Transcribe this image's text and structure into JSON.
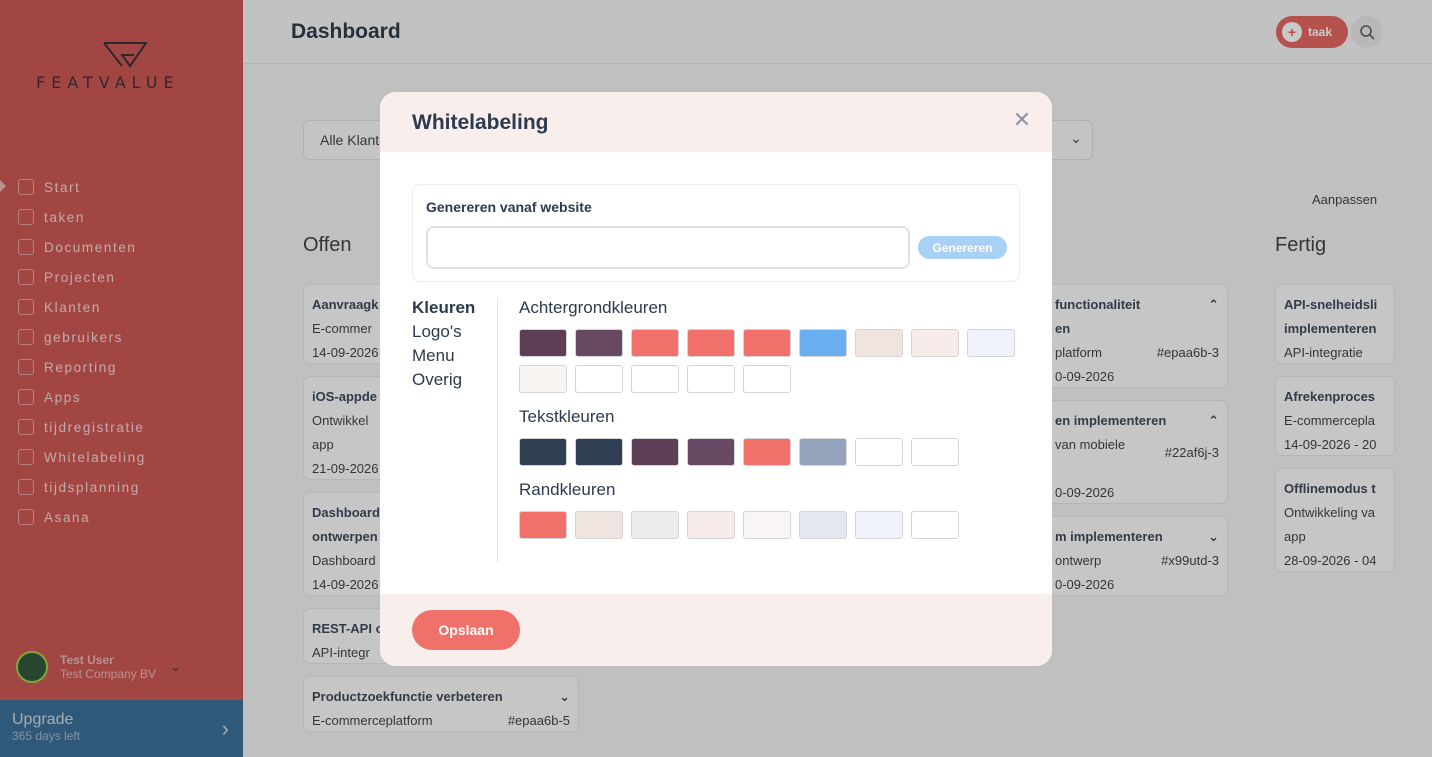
{
  "app": {
    "logo_text": "FEATVALUE",
    "page_title": "Dashboard",
    "add_task_label": "taak"
  },
  "sidebar": {
    "items": [
      {
        "label": "Start",
        "icon": "home-icon"
      },
      {
        "label": "taken",
        "icon": "checklist-icon"
      },
      {
        "label": "Documenten",
        "icon": "document-icon"
      },
      {
        "label": "Projecten",
        "icon": "chart-icon"
      },
      {
        "label": "Klanten",
        "icon": "building-icon"
      },
      {
        "label": "gebruikers",
        "icon": "user-icon"
      },
      {
        "label": "Reporting",
        "icon": "bar-chart-icon"
      },
      {
        "label": "Apps",
        "icon": "apps-icon"
      },
      {
        "label": "tijdregistratie",
        "icon": "clock-icon"
      },
      {
        "label": "Whitelabeling",
        "icon": "globe-icon"
      },
      {
        "label": "tijdsplanning",
        "icon": "calendar-icon"
      },
      {
        "label": "Asana",
        "icon": "apps-icon"
      }
    ],
    "user_name": "Test User",
    "user_company": "Test Company BV",
    "upgrade_title": "Upgrade",
    "upgrade_sub": "365 days left"
  },
  "board": {
    "filter_label": "Alle Klant",
    "aanpassen": "Aanpassen",
    "columns": [
      "Offen",
      "Fertig"
    ],
    "cards": [
      {
        "title": "Aanvraagk",
        "line2": "E-commer",
        "line3": "14-09-2026"
      },
      {
        "title": "iOS-appde",
        "line2": "Ontwikkel",
        "line3": "app",
        "line4": "21-09-2026"
      },
      {
        "title": "Dashboard",
        "line2": "ontwerpen",
        "line3": "Dashboard",
        "line4": "14-09-2026"
      },
      {
        "title": "REST-API o",
        "line2": "API-integr"
      },
      {
        "title": "Productzoekfunctie verbeteren",
        "line2": "E-commerceplatform",
        "num": "#epaa6b-5"
      },
      {
        "title": "functionaliteit",
        "line2": "en",
        "line3": "platform",
        "num": "#epaa6b-3",
        "line4": "0-09-2026"
      },
      {
        "title": "en implementeren",
        "line2": "van mobiele",
        "num": "#22af6j-3",
        "line4": "0-09-2026"
      },
      {
        "title": "m implementeren",
        "line2": "ontwerp",
        "num": "#x99utd-3",
        "line4": "0-09-2026"
      },
      {
        "title": "API-snelheidsli",
        "line2": "implementeren",
        "line3": "API-integratie"
      },
      {
        "title": "Afrekenproces",
        "line2": "E-commercepla",
        "line3": "14-09-2026 - 20"
      },
      {
        "title": "Offlinemodus t",
        "line2": "Ontwikkeling va",
        "line3": "app",
        "line4": "28-09-2026 - 04"
      }
    ]
  },
  "modal": {
    "title": "Whitelabeling",
    "gen_label": "Genereren vanaf website",
    "gen_input_value": "",
    "gen_button": "Genereren",
    "tabs": [
      "Kleuren",
      "Logo's",
      "Menu",
      "Overig"
    ],
    "groups": [
      {
        "title": "Achtergrondkleuren",
        "colors": [
          "#5e3e57",
          "#684963",
          "#f2706a",
          "#f2706a",
          "#f2706a",
          "#6aaef2",
          "#f0e4e1",
          "#f8eceb",
          "#f0f3f9",
          "#f8f4f2",
          "#ffffff",
          "#ffffff",
          "#ffffff",
          "#ffffff"
        ]
      },
      {
        "title": "Tekstkleuren",
        "colors": [
          "#2f3e52",
          "#2f3e52",
          "#5e3e57",
          "#684963",
          "#f2706a",
          "#96a3bc",
          "#ffffff",
          "#ffffff"
        ]
      },
      {
        "title": "Randkleuren",
        "colors": [
          "#f2706a",
          "#f0e4e1",
          "#ececec",
          "#f8eceb",
          "#f9f5f4",
          "#e3e8f0",
          "#f0f3f9",
          "#ffffff"
        ]
      }
    ],
    "save_button": "Opslaan"
  }
}
